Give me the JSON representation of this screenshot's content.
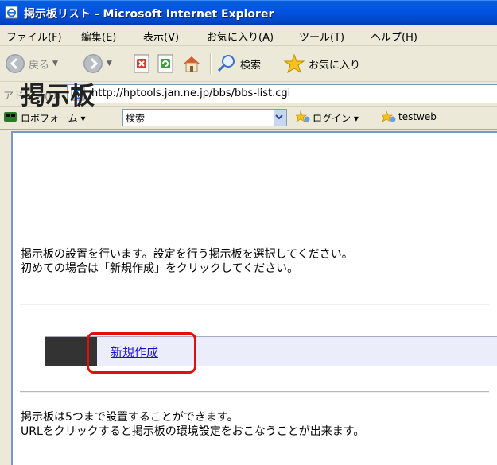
{
  "window": {
    "title": "掲示板リスト - Microsoft Internet Explorer"
  },
  "menu": {
    "items": [
      "ファイル(F)",
      "編集(E)",
      "表示(V)",
      "お気に入り(A)",
      "ツール(T)",
      "ヘルプ(H)"
    ]
  },
  "toolbar": {
    "back_label": "戻る",
    "search_label": "検索",
    "favorites_label": "お気に入り"
  },
  "address": {
    "label": "アドレス(D)",
    "url": "http://hptools.jan.ne.jp/bbs/bbs-list.cgi"
  },
  "links_bar": {
    "roboform": "ロボフォーム",
    "search_value": "検索",
    "login": "ログイン",
    "testweb": "testweb"
  },
  "page": {
    "heading": "掲示板",
    "intro_line1": "掲示板の設置を行います。設定を行う掲示板を選択してください。",
    "intro_line2": "初めての場合は「新規作成」をクリックしてください。",
    "new_link": "新規作成",
    "note_line1": "掲示板は5つまで設置することができます。",
    "note_line2": "URLをクリックすると掲示板の環境設定をおこなうことが出来ます。"
  },
  "colors": {
    "titlebar": "#0054e3",
    "link": "#1a0ddb",
    "highlight": "#e01010",
    "row_bg": "#ebeefa"
  }
}
